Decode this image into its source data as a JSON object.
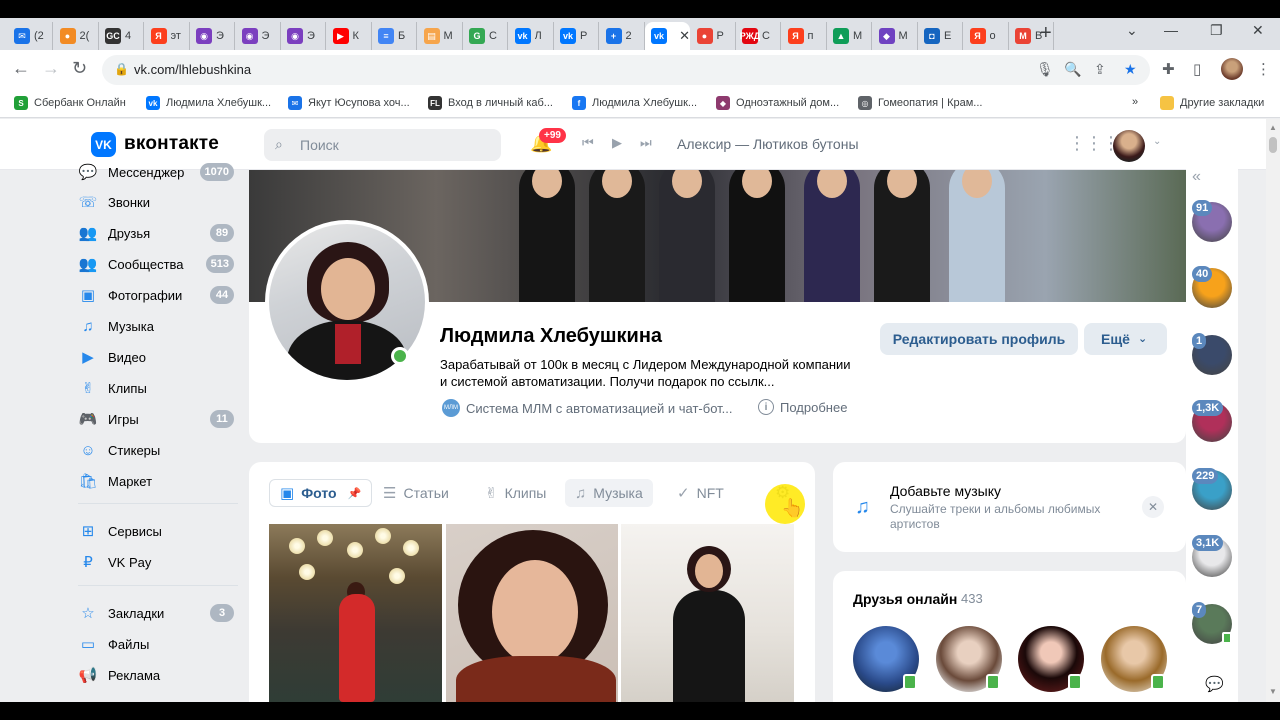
{
  "browser": {
    "tabs": [
      {
        "favicon_color": "#1a73e8",
        "favicon_glyph": "✉",
        "title": "(2"
      },
      {
        "favicon_color": "#f28b24",
        "favicon_glyph": "●",
        "title": "2("
      },
      {
        "favicon_color": "#333333",
        "favicon_glyph": "GC",
        "title": "4"
      },
      {
        "favicon_color": "#fc3f1d",
        "favicon_glyph": "Я",
        "title": "эт"
      },
      {
        "favicon_color": "#7b3fbf",
        "favicon_glyph": "◉",
        "title": "Э"
      },
      {
        "favicon_color": "#7b3fbf",
        "favicon_glyph": "◉",
        "title": "Э"
      },
      {
        "favicon_color": "#7b3fbf",
        "favicon_glyph": "◉",
        "title": "Э"
      },
      {
        "favicon_color": "#ff0000",
        "favicon_glyph": "▶",
        "title": "К"
      },
      {
        "favicon_color": "#4285f4",
        "favicon_glyph": "≡",
        "title": "Б"
      },
      {
        "favicon_color": "#f6a54c",
        "favicon_glyph": "▤",
        "title": "М"
      },
      {
        "favicon_color": "#34a853",
        "favicon_glyph": "G",
        "title": "С"
      },
      {
        "favicon_color": "#0077ff",
        "favicon_glyph": "vk",
        "title": "Л"
      },
      {
        "favicon_color": "#0077ff",
        "favicon_glyph": "vk",
        "title": "Р"
      },
      {
        "favicon_color": "#1a73e8",
        "favicon_glyph": "+",
        "title": "2"
      },
      {
        "favicon_color": "#0077ff",
        "favicon_glyph": "vk",
        "title": "",
        "active": true
      },
      {
        "favicon_color": "#ea4335",
        "favicon_glyph": "●",
        "title": "Р"
      },
      {
        "favicon_color": "#e30611",
        "favicon_glyph": "РЖД",
        "title": "С"
      },
      {
        "favicon_color": "#fc3f1d",
        "favicon_glyph": "Я",
        "title": "п"
      },
      {
        "favicon_color": "#0f9d58",
        "favicon_glyph": "▲",
        "title": "М"
      },
      {
        "favicon_color": "#6f42c1",
        "favicon_glyph": "◆",
        "title": "М"
      },
      {
        "favicon_color": "#1565c0",
        "favicon_glyph": "◘",
        "title": "Е"
      },
      {
        "favicon_color": "#fc3f1d",
        "favicon_glyph": "Я",
        "title": "о"
      },
      {
        "favicon_color": "#ea4335",
        "favicon_glyph": "M",
        "title": "В"
      }
    ],
    "address": "vk.com/lhlebushkina",
    "bookmarks": [
      {
        "label": "Сбербанк Онлайн",
        "color": "#21a038",
        "glyph": "S"
      },
      {
        "label": "Людмила Хлебушк...",
        "color": "#0077ff",
        "glyph": "vk"
      },
      {
        "label": "Якут Юсупова хоч...",
        "color": "#1a73e8",
        "glyph": "✉"
      },
      {
        "label": "Вход в личный каб...",
        "color": "#333333",
        "glyph": "FL"
      },
      {
        "label": "Людмила Хлебушк...",
        "color": "#1877f2",
        "glyph": "f"
      },
      {
        "label": "Одноэтажный дом...",
        "color": "#8e3a6e",
        "glyph": "◆"
      },
      {
        "label": "Гомеопатия | Крам...",
        "color": "#5f6368",
        "glyph": "◎"
      }
    ],
    "other_bookmarks": "Другие закладки"
  },
  "vk": {
    "brand": "вконтакте",
    "search_placeholder": "Поиск",
    "notifications_badge": "+99",
    "now_playing": "Алексир — Лютиков бутоны"
  },
  "left_nav": [
    {
      "label": "Мессенджер",
      "count": "1070",
      "icon": "message-icon",
      "glyph": "💬"
    },
    {
      "label": "Звонки",
      "count": "",
      "icon": "phone-icon",
      "glyph": "☏"
    },
    {
      "label": "Друзья",
      "count": "89",
      "icon": "friends-icon",
      "glyph": "👥"
    },
    {
      "label": "Сообщества",
      "count": "513",
      "icon": "communities-icon",
      "glyph": "👥"
    },
    {
      "label": "Фотографии",
      "count": "44",
      "icon": "photos-icon",
      "glyph": "▣"
    },
    {
      "label": "Музыка",
      "count": "",
      "icon": "music-icon",
      "glyph": "♫"
    },
    {
      "label": "Видео",
      "count": "",
      "icon": "video-icon",
      "glyph": "▶"
    },
    {
      "label": "Клипы",
      "count": "",
      "icon": "clips-icon",
      "glyph": "✌"
    },
    {
      "label": "Игры",
      "count": "11",
      "icon": "games-icon",
      "glyph": "🎮"
    },
    {
      "label": "Стикеры",
      "count": "",
      "icon": "stickers-icon",
      "glyph": "☺"
    },
    {
      "label": "Маркет",
      "count": "",
      "icon": "market-icon",
      "glyph": "🛍"
    },
    {
      "label": "Сервисы",
      "count": "",
      "icon": "services-icon",
      "glyph": "⊞"
    },
    {
      "label": "VK Pay",
      "count": "",
      "icon": "vkpay-icon",
      "glyph": "₽"
    },
    {
      "label": "Закладки",
      "count": "3",
      "icon": "bookmarks-icon",
      "glyph": "☆"
    },
    {
      "label": "Файлы",
      "count": "",
      "icon": "files-icon",
      "glyph": "▭"
    },
    {
      "label": "Реклама",
      "count": "",
      "icon": "ads-icon",
      "glyph": "📢"
    }
  ],
  "profile": {
    "name": "Людмила Хлебушкина",
    "status": "Зарабатывай от 100к в месяц с Лидером Международной компании и системой автоматизации. Получи подарок по ссылк...",
    "link_text": "Система МЛМ с автоматизацией и чат-бот...",
    "more_info": "Подробнее",
    "edit_button": "Редактировать профиль",
    "more_button": "Ещё"
  },
  "content_tabs": [
    {
      "label": "Фото",
      "icon": "photo-icon",
      "glyph": "▣",
      "state": "active"
    },
    {
      "label": "Статьи",
      "icon": "articles-icon",
      "glyph": "☰",
      "state": ""
    },
    {
      "label": "Клипы",
      "icon": "clips-icon",
      "glyph": "✌",
      "state": ""
    },
    {
      "label": "Музыка",
      "icon": "music-icon",
      "glyph": "♫",
      "state": "hover"
    },
    {
      "label": "NFT",
      "icon": "nft-icon",
      "glyph": "✓",
      "state": ""
    }
  ],
  "music_promo": {
    "title": "Добавьте музыку",
    "subtitle": "Слушайте треки и альбомы любимых артистов"
  },
  "friends_online": {
    "title": "Друзья онлайн",
    "count": "433"
  },
  "messenger_rail": [
    {
      "count": "91",
      "avatar_color": "#8a6fb0"
    },
    {
      "count": "40",
      "avatar_color": "#f7a21b"
    },
    {
      "count": "1",
      "avatar_color": "#3a4a6a"
    },
    {
      "count": "1,3K",
      "avatar_color": "#b0305a"
    },
    {
      "count": "229",
      "avatar_color": "#3aa0c8"
    },
    {
      "count": "3,1K",
      "avatar_color": "#e8e8ea"
    },
    {
      "count": "7",
      "avatar_color": "#5a7a5a"
    }
  ]
}
